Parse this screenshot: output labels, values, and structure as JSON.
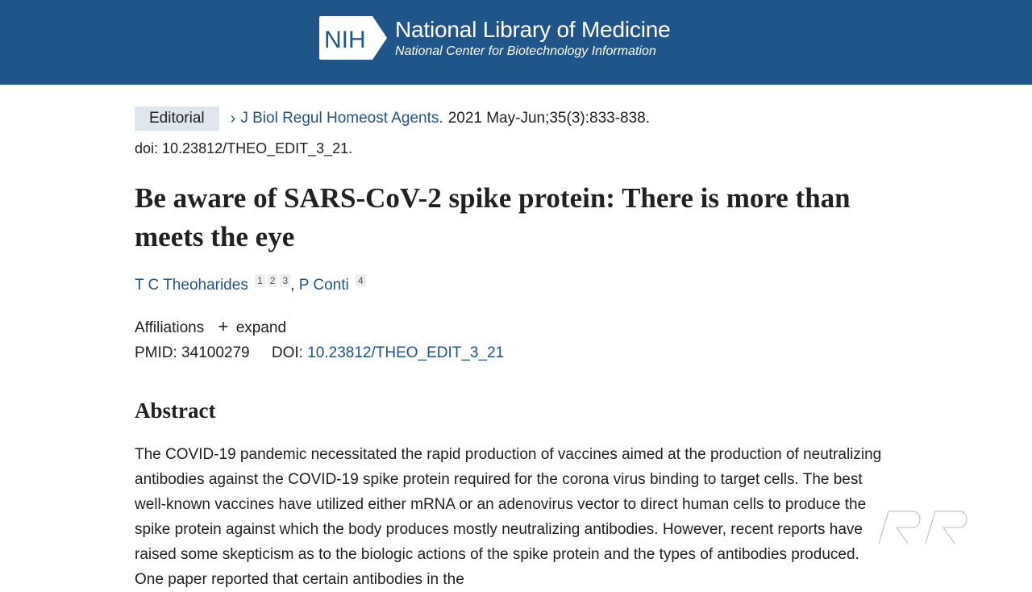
{
  "header": {
    "logo_text": "NIH",
    "title": "National Library of Medicine",
    "subtitle": "National Center for Biotechnology Information",
    "background": "#20558a"
  },
  "article": {
    "type_badge": "Editorial",
    "journal": "J Biol Regul Homeost Agents.",
    "citation": "2021 May-Jun;35(3):833-838.",
    "doi_line": "doi: 10.23812/THEO_EDIT_3_21.",
    "title": "Be aware of SARS-CoV-2 spike protein: There is more than meets the eye",
    "authors": [
      {
        "name": "T C Theoharides",
        "affiliations": [
          "1",
          "2",
          "3"
        ]
      },
      {
        "name": "P Conti",
        "affiliations": [
          "4"
        ]
      }
    ],
    "author_separator": ", ",
    "affiliations_label": "Affiliations",
    "expand_label": "expand",
    "pmid_label": "PMID: 34100279",
    "doi_label": "DOI:",
    "doi_value": "10.23812/THEO_EDIT_3_21"
  },
  "abstract": {
    "heading": "Abstract",
    "text": "The COVID-19 pandemic necessitated the rapid production of vaccines aimed at the production of neutralizing antibodies against the COVID-19 spike protein required for the corona virus binding to target cells. The best well-known vaccines have utilized either mRNA or an adenovirus vector to direct human cells to produce the spike protein against which the body produces mostly neutralizing antibodies. However, recent reports have raised some skepticism as to the biologic actions of the spike protein and the types of antibodies produced. One paper reported that certain antibodies in the"
  },
  "icons": {
    "chevron": "chevron-right-icon",
    "expand": "plus-icon",
    "watermark": "rr-watermark-logo"
  },
  "colors": {
    "link": "#20558a",
    "badge_bg": "#dfe6ee",
    "text": "#212121"
  }
}
